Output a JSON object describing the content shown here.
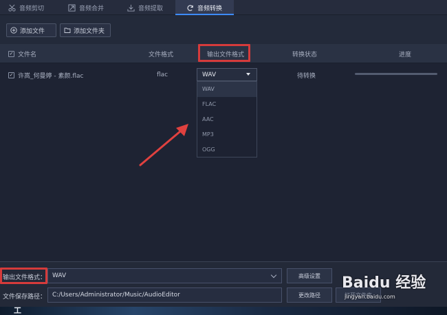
{
  "tabs": [
    {
      "label": "音频剪切",
      "icon": "scissors-icon"
    },
    {
      "label": "音频合并",
      "icon": "merge-icon"
    },
    {
      "label": "音频提取",
      "icon": "extract-icon"
    },
    {
      "label": "音频转换",
      "icon": "refresh-icon",
      "active": true
    }
  ],
  "toolbar": {
    "add_file": "添加文件",
    "add_folder": "添加文件夹"
  },
  "table": {
    "headers": {
      "name": "文件名",
      "format": "文件格式",
      "output_format": "输出文件格式",
      "status": "转换状态",
      "progress": "进度"
    },
    "rows": [
      {
        "name": "许嵩_何曼婷 - 素颜.flac",
        "format": "flac",
        "output_format": "WAV",
        "status": "待转换",
        "progress": 0
      }
    ]
  },
  "dropdown": {
    "options": [
      "WAV",
      "FLAC",
      "AAC",
      "MP3",
      "OGG"
    ],
    "selected": "WAV"
  },
  "bottom": {
    "output_format_label": "输出文件格式：",
    "output_format_value": "WAV",
    "advanced_button": "高级设置",
    "save_path_label": "文件保存路径：",
    "save_path_value": "C:/Users/Administrator/Music/AudioEditor",
    "change_path_button": "更改路径",
    "open_folder_button": "打开文件夹"
  },
  "taskbar": {
    "text": "工"
  },
  "watermark": {
    "logo": "Baidu 经验",
    "site": "jingyan.baidu.com"
  },
  "colors": {
    "accent": "#3d8bff",
    "highlight": "#d63b3b",
    "arrow": "#e0413f"
  }
}
